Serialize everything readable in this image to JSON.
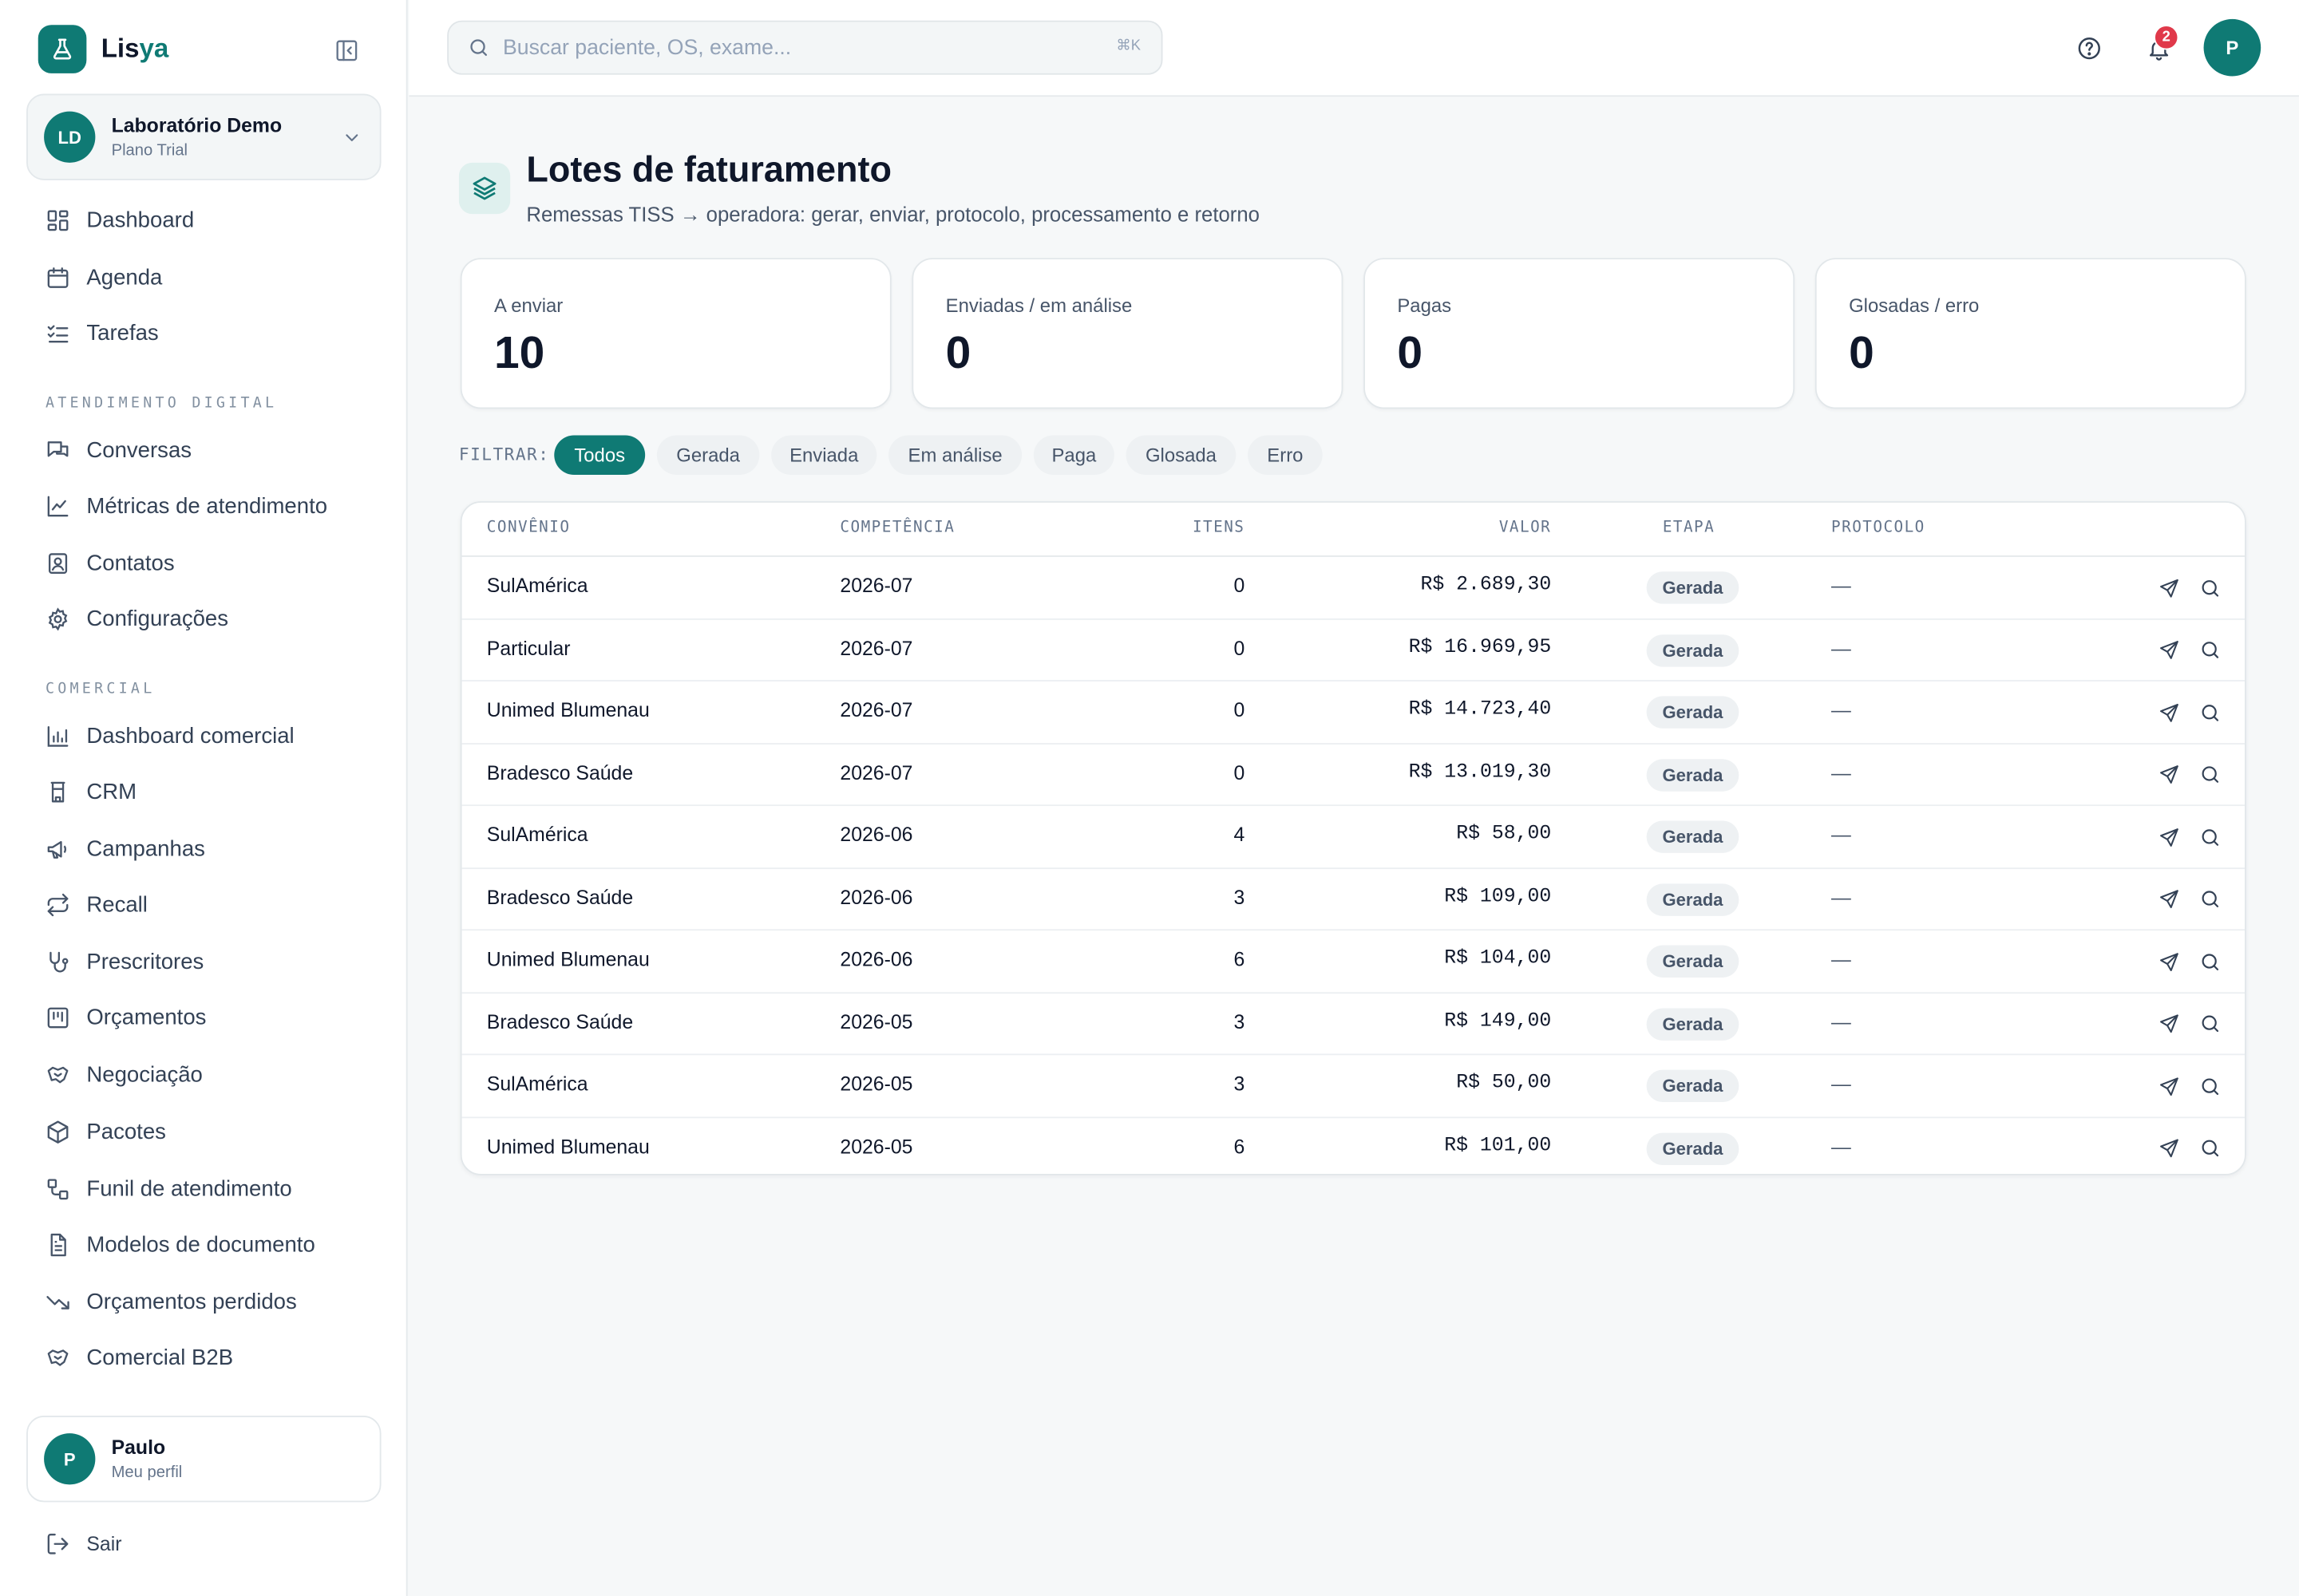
{
  "brand": {
    "name_main": "Lis",
    "name_accent": "ya"
  },
  "org": {
    "initials": "LD",
    "name": "Laboratório Demo",
    "plan": "Plano Trial"
  },
  "nav": {
    "main": [
      {
        "label": "Dashboard",
        "icon": "dashboard-icon"
      },
      {
        "label": "Agenda",
        "icon": "calendar-icon"
      },
      {
        "label": "Tarefas",
        "icon": "tasks-icon"
      }
    ],
    "section_digital": "ATENDIMENTO DIGITAL",
    "digital": [
      {
        "label": "Conversas",
        "icon": "chat-icon"
      },
      {
        "label": "Métricas de atendimento",
        "icon": "line-chart-icon"
      },
      {
        "label": "Contatos",
        "icon": "contact-icon"
      },
      {
        "label": "Configurações",
        "icon": "gear-icon"
      }
    ],
    "section_comercial": "COMERCIAL",
    "comercial": [
      {
        "label": "Dashboard comercial",
        "icon": "bar-chart-icon"
      },
      {
        "label": "CRM",
        "icon": "crm-icon"
      },
      {
        "label": "Campanhas",
        "icon": "megaphone-icon"
      },
      {
        "label": "Recall",
        "icon": "repeat-icon"
      },
      {
        "label": "Prescritores",
        "icon": "stethoscope-icon"
      },
      {
        "label": "Orçamentos",
        "icon": "budget-icon"
      },
      {
        "label": "Negociação",
        "icon": "handshake-icon"
      },
      {
        "label": "Pacotes",
        "icon": "package-icon"
      },
      {
        "label": "Funil de atendimento",
        "icon": "funnel-icon"
      },
      {
        "label": "Modelos de documento",
        "icon": "document-icon"
      },
      {
        "label": "Orçamentos perdidos",
        "icon": "trending-down-icon"
      },
      {
        "label": "Comercial B2B",
        "icon": "handshake-icon"
      }
    ]
  },
  "profile": {
    "initial": "P",
    "name": "Paulo",
    "sub": "Meu perfil"
  },
  "logout_label": "Sair",
  "search": {
    "placeholder": "Buscar paciente, OS, exame...",
    "shortcut": "⌘K"
  },
  "header": {
    "notifications_count": "2",
    "user_initial": "P"
  },
  "page": {
    "title": "Lotes de faturamento",
    "subtitle": "Remessas TISS → operadora: gerar, enviar, protocolo, processamento e retorno"
  },
  "stats": [
    {
      "label": "A enviar",
      "value": "10"
    },
    {
      "label": "Enviadas / em análise",
      "value": "0"
    },
    {
      "label": "Pagas",
      "value": "0"
    },
    {
      "label": "Glosadas / erro",
      "value": "0"
    }
  ],
  "filters": {
    "label": "FILTRAR:",
    "options": [
      "Todos",
      "Gerada",
      "Enviada",
      "Em análise",
      "Paga",
      "Glosada",
      "Erro"
    ],
    "active": "Todos"
  },
  "table": {
    "headers": {
      "convenio": "CONVÊNIO",
      "competencia": "COMPETÊNCIA",
      "itens": "ITENS",
      "valor": "VALOR",
      "etapa": "ETAPA",
      "protocolo": "PROTOCOLO"
    },
    "rows": [
      {
        "convenio": "SulAmérica",
        "competencia": "2026-07",
        "itens": "0",
        "valor": "R$ 2.689,30",
        "etapa": "Gerada",
        "protocolo": "—"
      },
      {
        "convenio": "Particular",
        "competencia": "2026-07",
        "itens": "0",
        "valor": "R$ 16.969,95",
        "etapa": "Gerada",
        "protocolo": "—"
      },
      {
        "convenio": "Unimed Blumenau",
        "competencia": "2026-07",
        "itens": "0",
        "valor": "R$ 14.723,40",
        "etapa": "Gerada",
        "protocolo": "—"
      },
      {
        "convenio": "Bradesco Saúde",
        "competencia": "2026-07",
        "itens": "0",
        "valor": "R$ 13.019,30",
        "etapa": "Gerada",
        "protocolo": "—"
      },
      {
        "convenio": "SulAmérica",
        "competencia": "2026-06",
        "itens": "4",
        "valor": "R$ 58,00",
        "etapa": "Gerada",
        "protocolo": "—"
      },
      {
        "convenio": "Bradesco Saúde",
        "competencia": "2026-06",
        "itens": "3",
        "valor": "R$ 109,00",
        "etapa": "Gerada",
        "protocolo": "—"
      },
      {
        "convenio": "Unimed Blumenau",
        "competencia": "2026-06",
        "itens": "6",
        "valor": "R$ 104,00",
        "etapa": "Gerada",
        "protocolo": "—"
      },
      {
        "convenio": "Bradesco Saúde",
        "competencia": "2026-05",
        "itens": "3",
        "valor": "R$ 149,00",
        "etapa": "Gerada",
        "protocolo": "—"
      },
      {
        "convenio": "SulAmérica",
        "competencia": "2026-05",
        "itens": "3",
        "valor": "R$ 50,00",
        "etapa": "Gerada",
        "protocolo": "—"
      },
      {
        "convenio": "Unimed Blumenau",
        "competencia": "2026-05",
        "itens": "6",
        "valor": "R$ 101,00",
        "etapa": "Gerada",
        "protocolo": "—"
      }
    ]
  },
  "colors": {
    "accent": "#0f7a74",
    "badge": "#e0394a"
  }
}
